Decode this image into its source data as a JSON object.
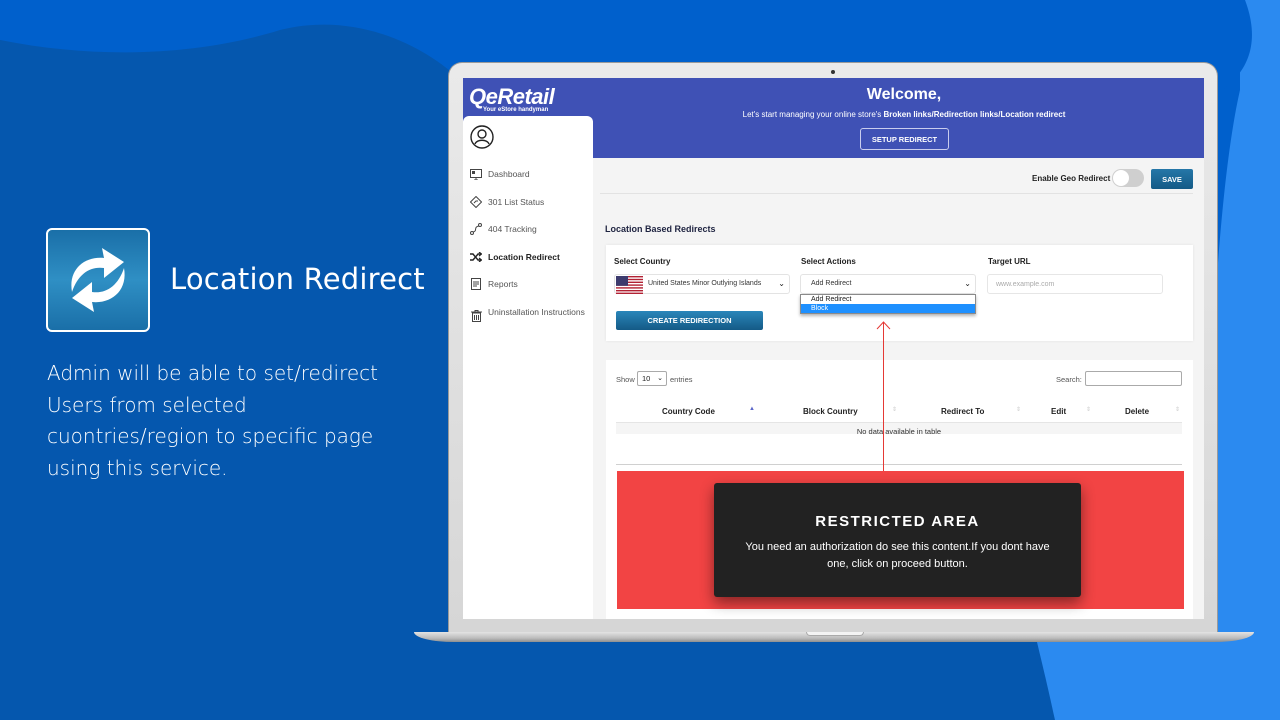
{
  "promo": {
    "title": "Location Redirect",
    "description": "Admin will be able to set/redirect Users from selected cuontries/region to specific page using this service.",
    "icon": "refresh-arrows-icon"
  },
  "app": {
    "logo": {
      "name": "QeRetail",
      "tagline": "Your eStore handyman"
    },
    "header": {
      "title": "Welcome,",
      "subtitle_prefix": "Let's start managing your online store's ",
      "subtitle_bold": "Broken links/Redirection links/Location redirect",
      "setup_button": "SETUP REDIRECT"
    },
    "sidebar": {
      "items": [
        {
          "label": "Dashboard",
          "icon": "dashboard-icon",
          "active": false
        },
        {
          "label": "301 List Status",
          "icon": "diamond-arrow-icon",
          "active": false
        },
        {
          "label": "404 Tracking",
          "icon": "route-icon",
          "active": false
        },
        {
          "label": "Location Redirect",
          "icon": "shuffle-icon",
          "active": true
        },
        {
          "label": "Reports",
          "icon": "report-icon",
          "active": false
        },
        {
          "label": "Uninstallation Instructions",
          "icon": "trash-icon",
          "active": false
        }
      ]
    },
    "controls": {
      "geo_redirect_label": "Enable Geo Redirect",
      "geo_redirect_enabled": false,
      "save_button": "SAVE"
    },
    "section_title": "Location Based Redirects",
    "form": {
      "country_label": "Select Country",
      "country_value": "United States Minor Outlying Islands",
      "actions_label": "Select Actions",
      "actions_value": "Add Redirect",
      "actions_options": [
        "Add Redirect",
        "Block"
      ],
      "actions_highlighted": "Block",
      "target_label": "Target URL",
      "target_placeholder": "www.example.com",
      "target_value": "",
      "create_button": "CREATE REDIRECTION"
    },
    "table": {
      "show_label": "Show",
      "entries_value": "10",
      "entries_label": "entries",
      "search_label": "Search:",
      "search_value": "",
      "columns": [
        "Country Code",
        "Block Country",
        "Redirect To",
        "Edit",
        "Delete"
      ],
      "sorted_column": "Country Code",
      "empty_message": "No data available in table",
      "rows": []
    },
    "restricted": {
      "title": "RESTRICTED AREA",
      "message": "You need an authorization do see this content.If you dont have one, click on proceed button."
    }
  },
  "colors": {
    "background": "#0060cc",
    "header": "#3f51b5",
    "primary_button": "#1a6a9a",
    "restricted_bg": "#f24444",
    "restricted_box": "#222222",
    "dropdown_highlight": "#1e90ff"
  }
}
